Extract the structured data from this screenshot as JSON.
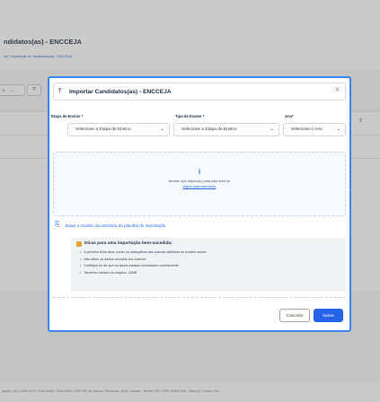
{
  "background": {
    "page_title": "ndidatos(as) - ENCCEJA",
    "breadcrumb": "es) / Importação de Candidatos(as) - ENCCEJA",
    "filter_value": "s",
    "filter_chevron_icon": "chevron-down-icon",
    "filter_button_icon": "filter-icon",
    "sort_icon": "sort-icon",
    "footer_text": "gação  •  (81) 3183-8075 / 3183-8082 / 3183-8092  •  SEE-PE: Av. Afonso Olindense, 1513, Várzea, - Recife | PE / CEP: 50810-000 - Bloco B, Térreo  •  Pol"
  },
  "modal": {
    "title": "Importar Candidatos(as) - ENCCEJA",
    "title_icon": "import-icon",
    "close_icon": "close-icon",
    "fields": [
      {
        "label": "Etapa de Ensino *",
        "value": "Selecione a Etapa de Ensino"
      },
      {
        "label": "Tipo de Exame *",
        "value": "Selecione a Etapa de Ensino"
      },
      {
        "label": "Ano*",
        "value": "Selecione o Ano"
      }
    ],
    "dropzone": {
      "icon": "upload-icon",
      "text": "Arraste o(s) arquivo(s) para esta área ou",
      "link": "clique para selecionar"
    },
    "download": {
      "icon": "file-download-icon",
      "label": "Baixe o modelo da estrutura da planilha de importação"
    },
    "tips": {
      "icon": "lightbulb-icon",
      "title": "Dicas para uma importação bem-sucedida:",
      "items": [
        "A primeira linha deve conter os cabeçalhos das colunas definidas no modelo acima",
        "Não altere os dados oriundos dos exames",
        "Certifique-se de que os dados estejam formatados corretamente",
        "Tamanho máximo do arquivo: 20MB"
      ]
    },
    "cancel_label": "Cancelar",
    "save_label": "Salvar"
  },
  "colors": {
    "accent": "#2563eb",
    "modal_border": "#3b82f6",
    "title_text": "#1f2a44"
  }
}
